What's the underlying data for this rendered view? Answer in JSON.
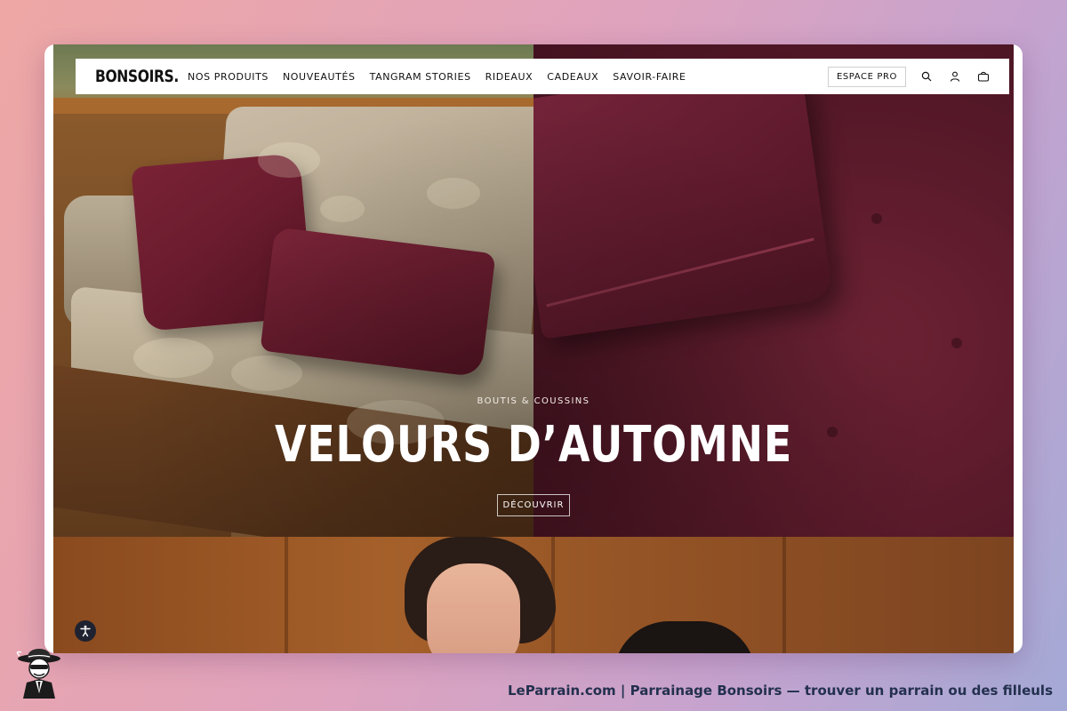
{
  "header": {
    "logo": "BONSOIRS.",
    "nav": [
      {
        "label": "NOS PRODUITS"
      },
      {
        "label": "NOUVEAUTÉS"
      },
      {
        "label": "TANGRAM STORIES"
      },
      {
        "label": "RIDEAUX"
      },
      {
        "label": "CADEAUX"
      },
      {
        "label": "SAVOIR-FAIRE"
      }
    ],
    "espace_pro": "ESPACE PRO",
    "icons": [
      "search-icon",
      "account-icon",
      "cart-icon"
    ]
  },
  "hero": {
    "eyebrow": "BOUTIS & COUSSINS",
    "title": "VELOURS D’AUTOMNE",
    "cta": "DÉCOUVRIR"
  },
  "footer": {
    "caption": "LeParrain.com | Parrainage Bonsoirs — trouver un parrain ou des filleuls"
  },
  "colors": {
    "accent_burgundy": "#5a1a2a",
    "footer_text": "#23304e"
  }
}
